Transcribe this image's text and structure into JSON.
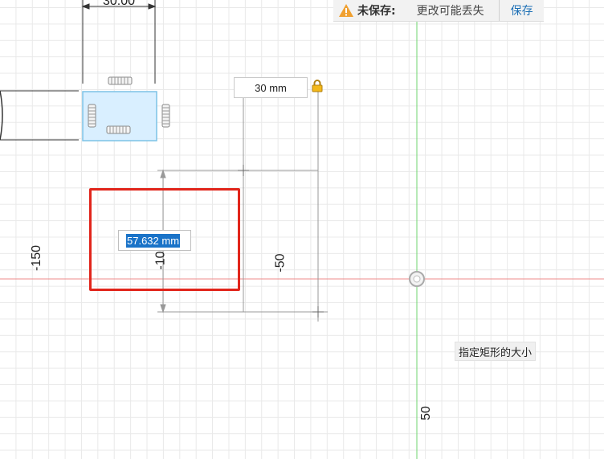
{
  "top_dimension_partial": "30.00",
  "warning": {
    "title": "未保存:",
    "message": "更改可能丢失",
    "save_label": "保存"
  },
  "inputs": {
    "width_value": "30 mm",
    "active_value": "57.632 mm"
  },
  "dimension_labels": {
    "left_axis": "-150",
    "inner_height": "-10",
    "right_height": "-50",
    "bottom_axis": "50"
  },
  "tooltip": "指定矩形的大小",
  "colors": {
    "x_axis": "#ef8b8b",
    "y_axis": "#6fd66f",
    "highlight": "#e1251b",
    "sketch_rect_fill": "#d9efff",
    "sketch_rect_stroke": "#7cc2e6",
    "link": "#1c6fb5",
    "selection": "#1a73c8"
  },
  "icons": {
    "warning": "warning-triangle-icon",
    "lock": "lock-icon",
    "origin": "origin-point-icon",
    "constraint": "horizontal-vertical-constraint-icon"
  }
}
